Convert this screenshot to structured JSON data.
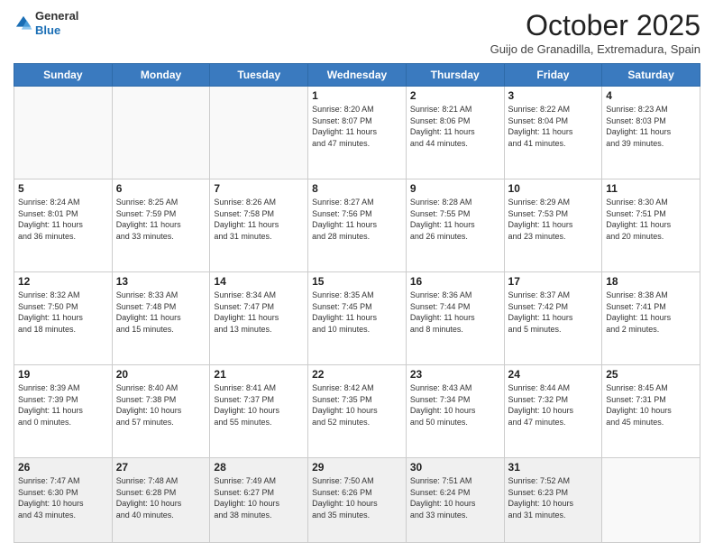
{
  "logo": {
    "line1": "General",
    "line2": "Blue"
  },
  "header": {
    "month": "October 2025",
    "location": "Guijo de Granadilla, Extremadura, Spain"
  },
  "weekdays": [
    "Sunday",
    "Monday",
    "Tuesday",
    "Wednesday",
    "Thursday",
    "Friday",
    "Saturday"
  ],
  "weeks": [
    [
      {
        "day": "",
        "info": ""
      },
      {
        "day": "",
        "info": ""
      },
      {
        "day": "",
        "info": ""
      },
      {
        "day": "1",
        "info": "Sunrise: 8:20 AM\nSunset: 8:07 PM\nDaylight: 11 hours\nand 47 minutes."
      },
      {
        "day": "2",
        "info": "Sunrise: 8:21 AM\nSunset: 8:06 PM\nDaylight: 11 hours\nand 44 minutes."
      },
      {
        "day": "3",
        "info": "Sunrise: 8:22 AM\nSunset: 8:04 PM\nDaylight: 11 hours\nand 41 minutes."
      },
      {
        "day": "4",
        "info": "Sunrise: 8:23 AM\nSunset: 8:03 PM\nDaylight: 11 hours\nand 39 minutes."
      }
    ],
    [
      {
        "day": "5",
        "info": "Sunrise: 8:24 AM\nSunset: 8:01 PM\nDaylight: 11 hours\nand 36 minutes."
      },
      {
        "day": "6",
        "info": "Sunrise: 8:25 AM\nSunset: 7:59 PM\nDaylight: 11 hours\nand 33 minutes."
      },
      {
        "day": "7",
        "info": "Sunrise: 8:26 AM\nSunset: 7:58 PM\nDaylight: 11 hours\nand 31 minutes."
      },
      {
        "day": "8",
        "info": "Sunrise: 8:27 AM\nSunset: 7:56 PM\nDaylight: 11 hours\nand 28 minutes."
      },
      {
        "day": "9",
        "info": "Sunrise: 8:28 AM\nSunset: 7:55 PM\nDaylight: 11 hours\nand 26 minutes."
      },
      {
        "day": "10",
        "info": "Sunrise: 8:29 AM\nSunset: 7:53 PM\nDaylight: 11 hours\nand 23 minutes."
      },
      {
        "day": "11",
        "info": "Sunrise: 8:30 AM\nSunset: 7:51 PM\nDaylight: 11 hours\nand 20 minutes."
      }
    ],
    [
      {
        "day": "12",
        "info": "Sunrise: 8:32 AM\nSunset: 7:50 PM\nDaylight: 11 hours\nand 18 minutes."
      },
      {
        "day": "13",
        "info": "Sunrise: 8:33 AM\nSunset: 7:48 PM\nDaylight: 11 hours\nand 15 minutes."
      },
      {
        "day": "14",
        "info": "Sunrise: 8:34 AM\nSunset: 7:47 PM\nDaylight: 11 hours\nand 13 minutes."
      },
      {
        "day": "15",
        "info": "Sunrise: 8:35 AM\nSunset: 7:45 PM\nDaylight: 11 hours\nand 10 minutes."
      },
      {
        "day": "16",
        "info": "Sunrise: 8:36 AM\nSunset: 7:44 PM\nDaylight: 11 hours\nand 8 minutes."
      },
      {
        "day": "17",
        "info": "Sunrise: 8:37 AM\nSunset: 7:42 PM\nDaylight: 11 hours\nand 5 minutes."
      },
      {
        "day": "18",
        "info": "Sunrise: 8:38 AM\nSunset: 7:41 PM\nDaylight: 11 hours\nand 2 minutes."
      }
    ],
    [
      {
        "day": "19",
        "info": "Sunrise: 8:39 AM\nSunset: 7:39 PM\nDaylight: 11 hours\nand 0 minutes."
      },
      {
        "day": "20",
        "info": "Sunrise: 8:40 AM\nSunset: 7:38 PM\nDaylight: 10 hours\nand 57 minutes."
      },
      {
        "day": "21",
        "info": "Sunrise: 8:41 AM\nSunset: 7:37 PM\nDaylight: 10 hours\nand 55 minutes."
      },
      {
        "day": "22",
        "info": "Sunrise: 8:42 AM\nSunset: 7:35 PM\nDaylight: 10 hours\nand 52 minutes."
      },
      {
        "day": "23",
        "info": "Sunrise: 8:43 AM\nSunset: 7:34 PM\nDaylight: 10 hours\nand 50 minutes."
      },
      {
        "day": "24",
        "info": "Sunrise: 8:44 AM\nSunset: 7:32 PM\nDaylight: 10 hours\nand 47 minutes."
      },
      {
        "day": "25",
        "info": "Sunrise: 8:45 AM\nSunset: 7:31 PM\nDaylight: 10 hours\nand 45 minutes."
      }
    ],
    [
      {
        "day": "26",
        "info": "Sunrise: 7:47 AM\nSunset: 6:30 PM\nDaylight: 10 hours\nand 43 minutes."
      },
      {
        "day": "27",
        "info": "Sunrise: 7:48 AM\nSunset: 6:28 PM\nDaylight: 10 hours\nand 40 minutes."
      },
      {
        "day": "28",
        "info": "Sunrise: 7:49 AM\nSunset: 6:27 PM\nDaylight: 10 hours\nand 38 minutes."
      },
      {
        "day": "29",
        "info": "Sunrise: 7:50 AM\nSunset: 6:26 PM\nDaylight: 10 hours\nand 35 minutes."
      },
      {
        "day": "30",
        "info": "Sunrise: 7:51 AM\nSunset: 6:24 PM\nDaylight: 10 hours\nand 33 minutes."
      },
      {
        "day": "31",
        "info": "Sunrise: 7:52 AM\nSunset: 6:23 PM\nDaylight: 10 hours\nand 31 minutes."
      },
      {
        "day": "",
        "info": ""
      }
    ]
  ]
}
